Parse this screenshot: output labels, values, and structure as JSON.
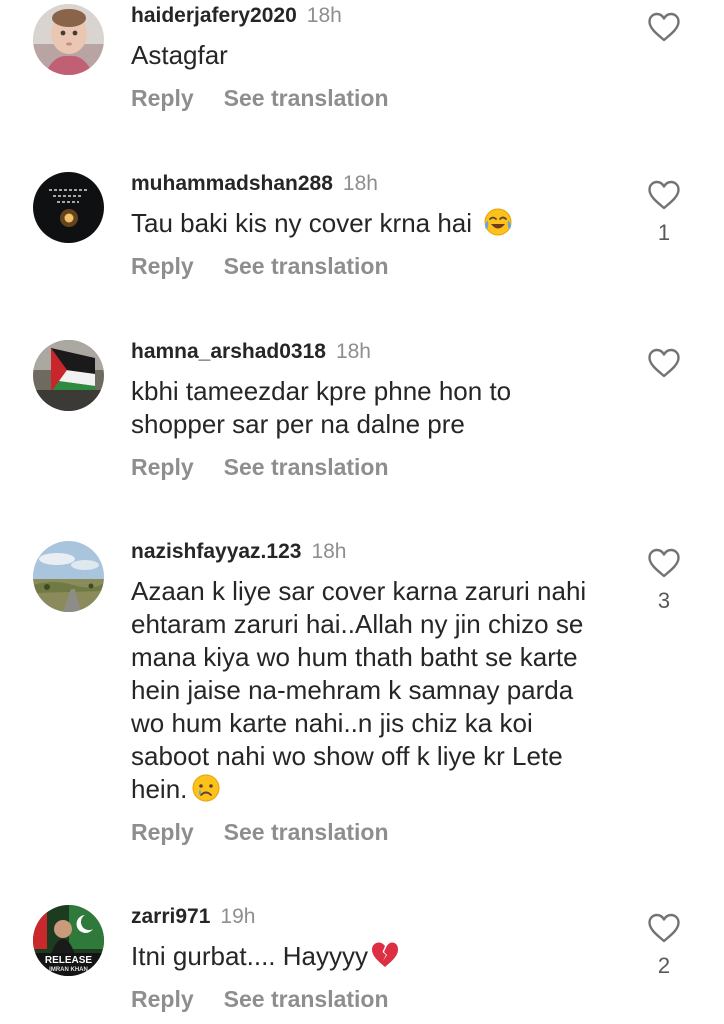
{
  "comments": [
    {
      "username": "haiderjafery2020",
      "time": "18h",
      "text": "Astagfar",
      "emoji": "",
      "reply_label": "Reply",
      "translate_label": "See translation",
      "likes": "",
      "avatar_icon": "child-photo-avatar"
    },
    {
      "username": "muhammadshan288",
      "time": "18h",
      "text": "Tau baki kis ny cover krna hai ",
      "emoji": "face-with-tears-of-joy",
      "reply_label": "Reply",
      "translate_label": "See translation",
      "likes": "1",
      "avatar_icon": "night-light-avatar"
    },
    {
      "username": "hamna_arshad0318",
      "time": "18h",
      "text": "kbhi tameezdar kpre phne hon to\nshopper sar per na dalne pre",
      "emoji": "",
      "reply_label": "Reply",
      "translate_label": "See translation",
      "likes": "",
      "avatar_icon": "flag-avatar"
    },
    {
      "username": "nazishfayyaz.123",
      "time": "18h",
      "text": "Azaan k liye sar cover karna zaruri nahi\nehtaram zaruri hai..Allah ny jin chizo se\nmana kiya wo hum thath batht se karte\nhein jaise na-mehram k samnay parda\nwo hum karte nahi..n jis chiz ka koi\nsaboot nahi wo show off k liye kr Lete\nhein.",
      "emoji": "crying-face",
      "reply_label": "Reply",
      "translate_label": "See translation",
      "likes": "3",
      "avatar_icon": "landscape-avatar"
    },
    {
      "username": "zarri971",
      "time": "19h",
      "text": "Itni gurbat.... Hayyyy",
      "emoji": "broken-heart",
      "reply_label": "Reply",
      "translate_label": "See translation",
      "likes": "2",
      "avatar_icon": "release-imran-khan-avatar"
    }
  ],
  "avatars": {
    "0": {
      "text": ""
    },
    "1": {
      "text": ""
    },
    "2": {
      "text": ""
    },
    "3": {
      "text": ""
    },
    "4": {
      "line1": "RELEASE",
      "line2": "IMRAN KHAN"
    }
  },
  "colors": {
    "username": "#262626",
    "meta": "#8e8e8e",
    "text": "#262626"
  }
}
